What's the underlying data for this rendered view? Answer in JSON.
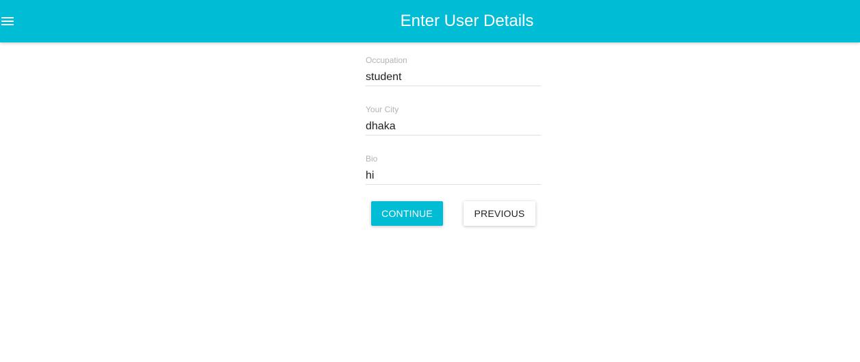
{
  "app_bar": {
    "title": "Enter User Details",
    "menu_icon": "hamburger-menu-icon",
    "color": "#00bcd4"
  },
  "form": {
    "fields": [
      {
        "label": "Occupation",
        "value": "student"
      },
      {
        "label": "Your City",
        "value": "dhaka"
      },
      {
        "label": "Bio",
        "value": "hi"
      }
    ]
  },
  "actions": {
    "continue_label": "CONTINUE",
    "previous_label": "PREVIOUS"
  }
}
